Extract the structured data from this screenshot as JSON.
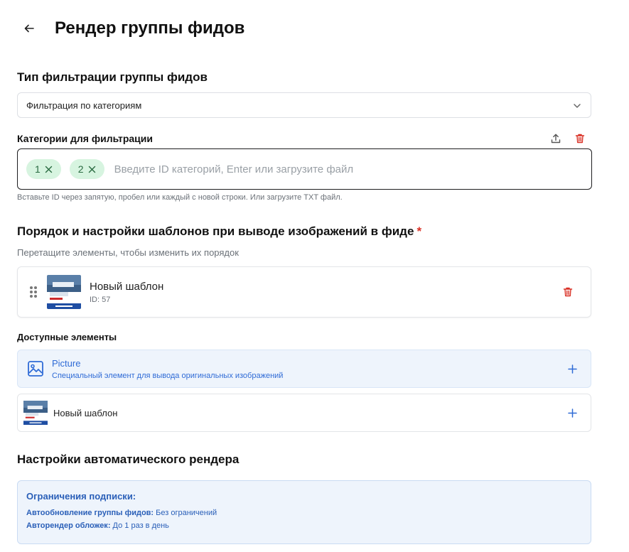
{
  "page": {
    "title": "Рендер группы фидов"
  },
  "filter_type": {
    "label": "Тип фильтрации группы фидов",
    "selected": "Фильтрация по категориям"
  },
  "categories": {
    "label": "Категории для фильтрации",
    "tags": [
      "1",
      "2"
    ],
    "placeholder": "Введите ID категорий, Enter или загрузите файл",
    "hint": "Вставьте ID через запятую, пробел или каждый с новой строки. Или загрузите TXT файл."
  },
  "templates": {
    "label": "Порядок и настройки шаблонов при выводе изображений в фиде",
    "required_mark": "*",
    "drag_hint": "Перетащите элементы, чтобы изменить их порядок",
    "items": [
      {
        "name": "Новый шаблон",
        "id_text": "ID: 57"
      }
    ]
  },
  "available": {
    "label": "Доступные элементы",
    "picture": {
      "name": "Picture",
      "description": "Специальный элемент для вывода оригинальных изображений"
    },
    "template": {
      "name": "Новый шаблон"
    }
  },
  "auto_render": {
    "label": "Настройки автоматического рендера",
    "limits_title": "Ограничения подписки:",
    "rows": [
      {
        "key": "Автообновление группы фидов:",
        "value": " Без ограничений"
      },
      {
        "key": "Авторендер обложек:",
        "value": " До 1 раз в день"
      }
    ]
  },
  "colors": {
    "accent_blue": "#2f6bd6",
    "danger_red": "#d93025",
    "tag_green_bg": "#d7f4e0",
    "info_bg": "#eef4fc"
  },
  "icons": [
    "arrow-left-icon",
    "chevron-down-icon",
    "upload-icon",
    "trash-icon",
    "drag-handle-icon",
    "image-icon",
    "plus-icon",
    "close-icon"
  ]
}
